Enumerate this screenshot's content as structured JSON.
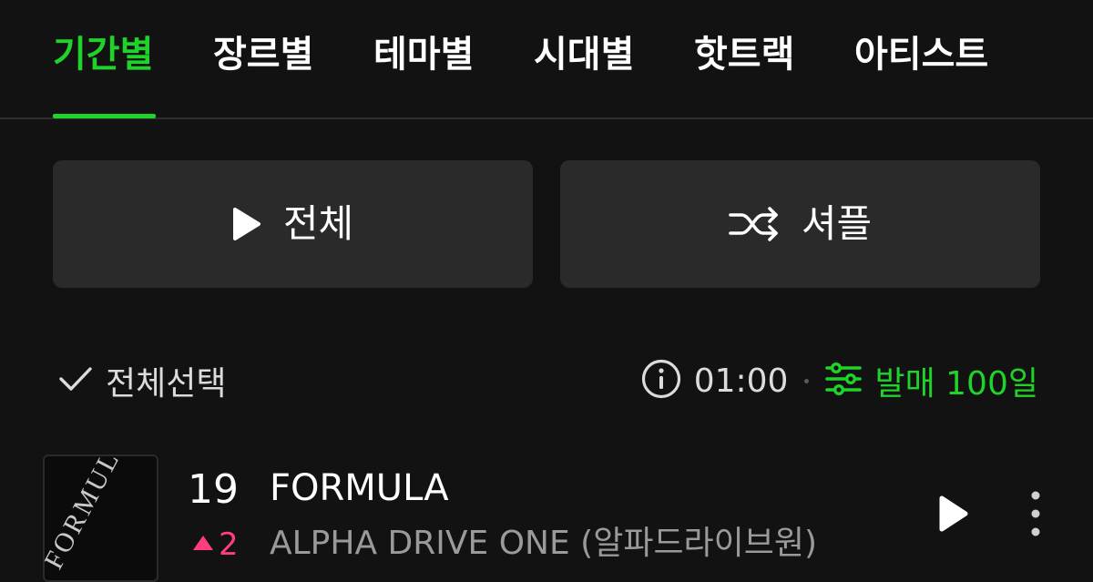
{
  "tabs": [
    {
      "label": "기간별",
      "active": true
    },
    {
      "label": "장르별",
      "active": false
    },
    {
      "label": "테마별",
      "active": false
    },
    {
      "label": "시대별",
      "active": false
    },
    {
      "label": "핫트랙",
      "active": false
    },
    {
      "label": "아티스트",
      "active": false
    }
  ],
  "actions": {
    "play_all_label": "전체",
    "shuffle_label": "셔플"
  },
  "options": {
    "select_all_label": "전체선택",
    "time": "01:00",
    "filter_label": "발매 100일"
  },
  "tracks": [
    {
      "rank": "19",
      "rank_change": "2",
      "rank_direction": "up",
      "title": "FORMULA",
      "artist": "ALPHA DRIVE ONE (알파드라이브원)",
      "album_art_text": "FORMULA"
    }
  ],
  "colors": {
    "accent": "#1fd32a",
    "rank_up": "#ff3d7f",
    "background": "#121212",
    "button_bg": "#2a2a2a"
  },
  "icons": {
    "play": "play-icon",
    "shuffle": "shuffle-icon",
    "check": "check-icon",
    "info": "info-icon",
    "filter": "sliders-icon",
    "more": "more-vertical-icon",
    "rank_up": "triangle-up-icon"
  }
}
